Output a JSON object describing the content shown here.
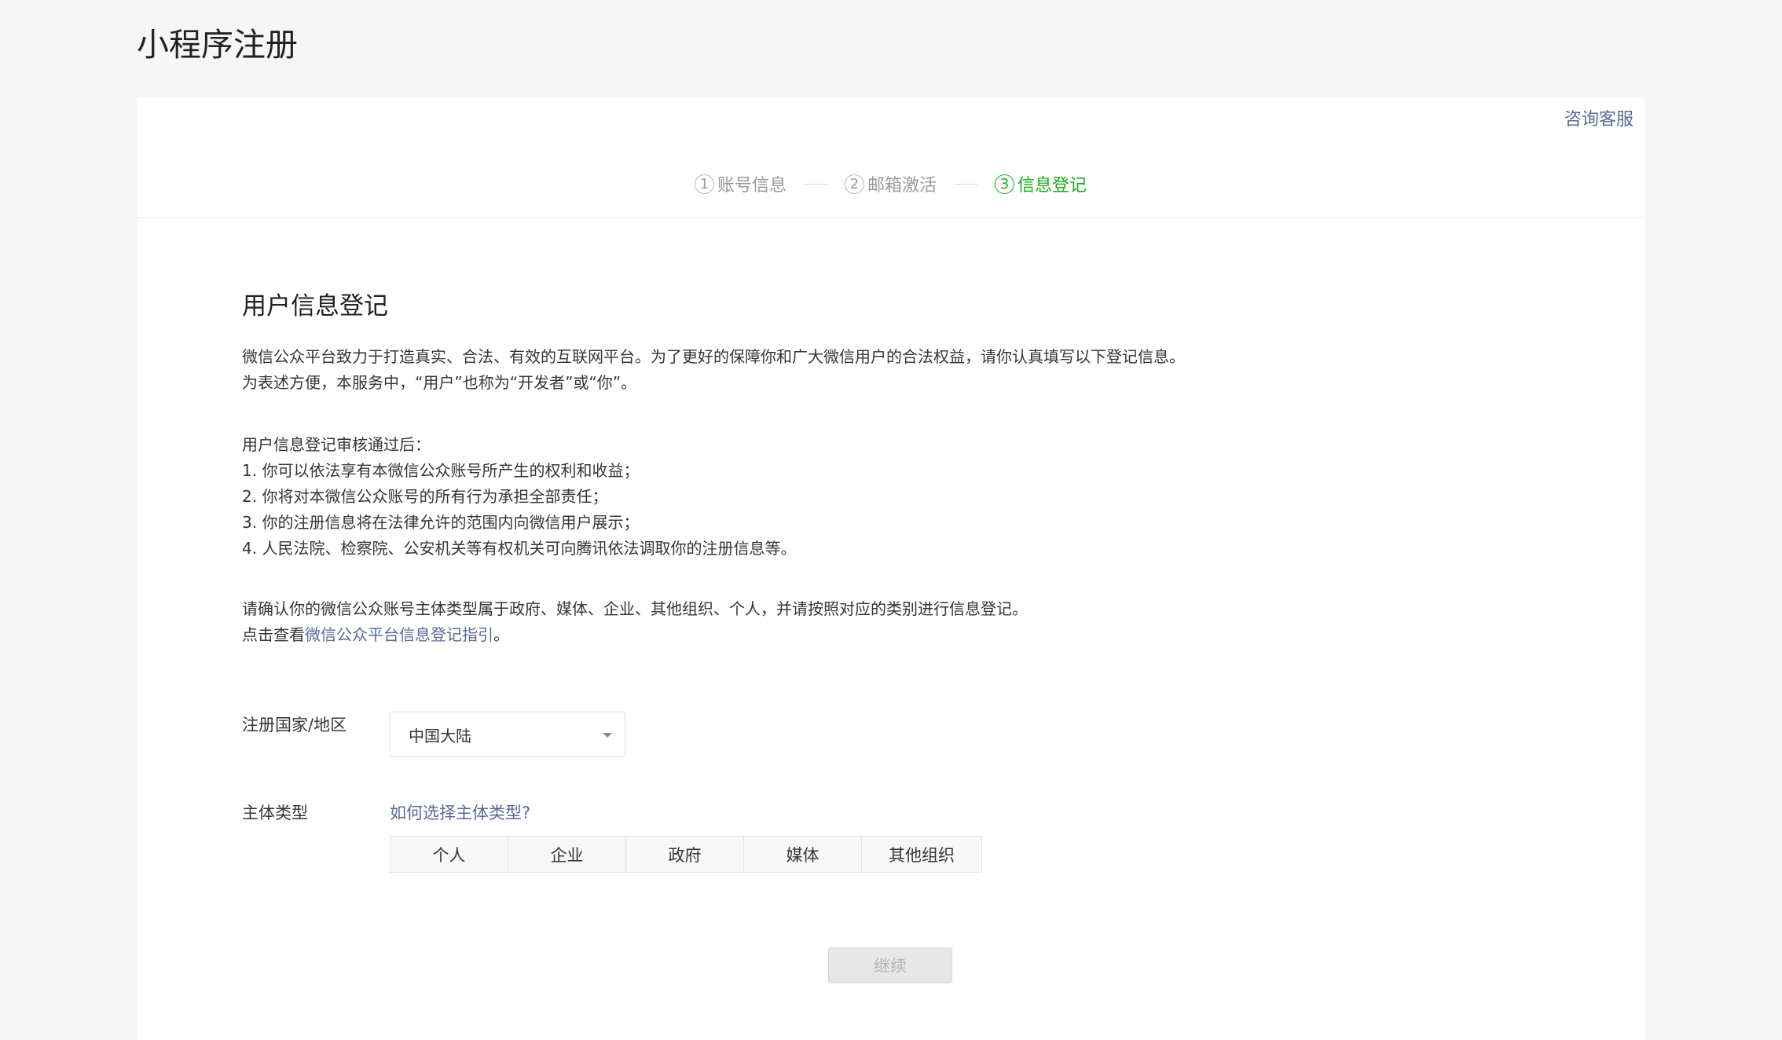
{
  "page": {
    "title": "小程序注册"
  },
  "header": {
    "support_link": "咨询客服"
  },
  "steps": [
    {
      "num": "1",
      "label": "账号信息",
      "active": false
    },
    {
      "num": "2",
      "label": "邮箱激活",
      "active": false
    },
    {
      "num": "3",
      "label": "信息登记",
      "active": true
    }
  ],
  "content": {
    "title": "用户信息登记",
    "intro_1": "微信公众平台致力于打造真实、合法、有效的互联网平台。为了更好的保障你和广大微信用户的合法权益，请你认真填写以下登记信息。",
    "intro_2": "为表述方便，本服务中，“用户”也称为“开发者”或“你”。",
    "after_title": "用户信息登记审核通过后：",
    "after_items": [
      "1. 你可以依法享有本微信公众账号所产生的权利和收益；",
      "2. 你将对本微信公众账号的所有行为承担全部责任；",
      "3. 你的注册信息将在法律允许的范围内向微信用户展示；",
      "4. 人民法院、检察院、公安机关等有权机关可向腾讯依法调取你的注册信息等。"
    ],
    "confirm_text": "请确认你的微信公众账号主体类型属于政府、媒体、企业、其他组织、个人，并请按照对应的类别进行信息登记。",
    "guide_prefix": "点击查看",
    "guide_link": "微信公众平台信息登记指引",
    "guide_suffix": "。"
  },
  "form": {
    "region_label": "注册国家/地区",
    "region_value": "中国大陆",
    "type_label": "主体类型",
    "type_help": "如何选择主体类型?",
    "type_options": [
      "个人",
      "企业",
      "政府",
      "媒体",
      "其他组织"
    ]
  },
  "actions": {
    "continue_label": "继续"
  },
  "colors": {
    "accent_green": "#1aad19",
    "link_blue": "#576b95"
  }
}
